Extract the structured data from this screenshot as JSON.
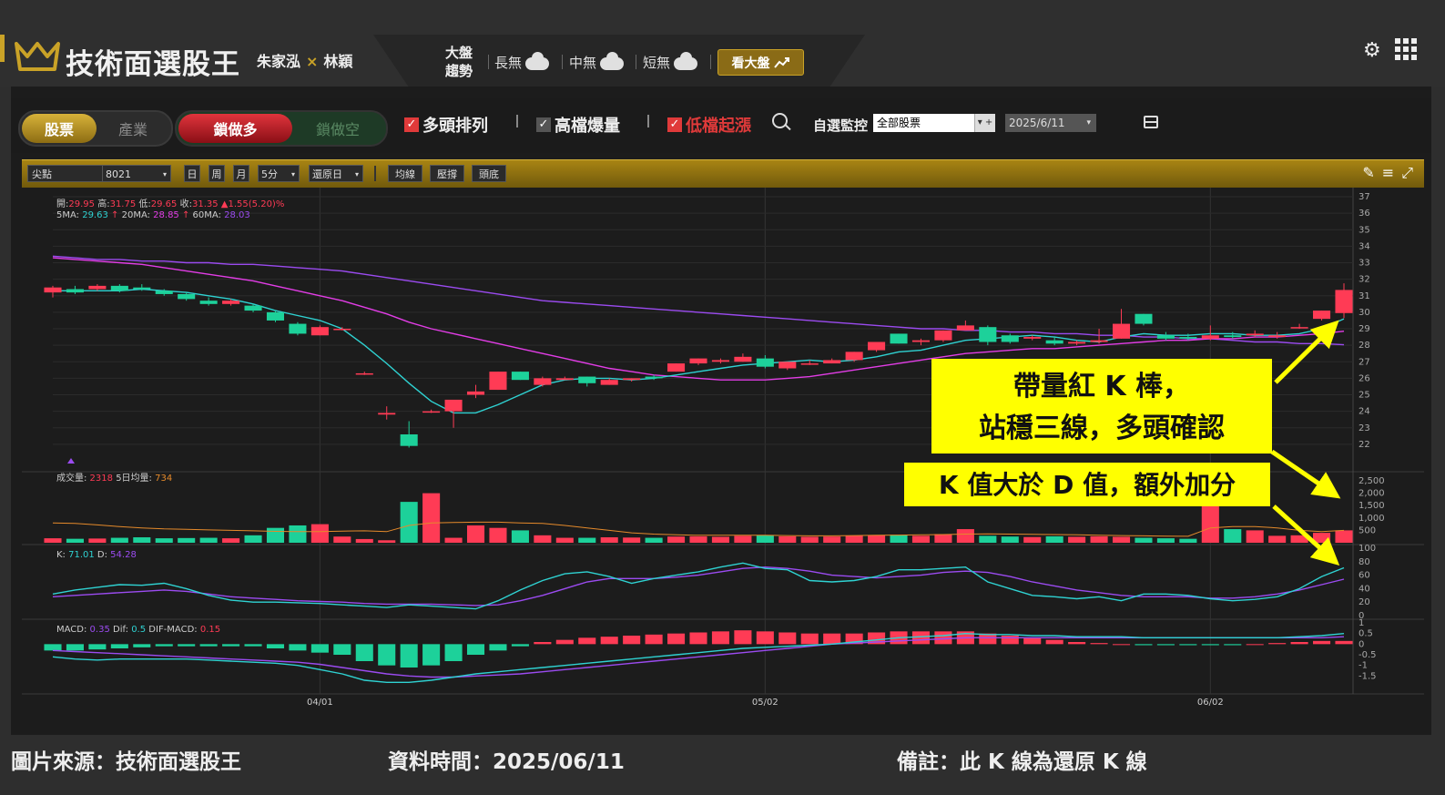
{
  "header": {
    "app_title": "技術面選股王",
    "authors_left": "朱家泓",
    "authors_x": "×",
    "authors_right": "林穎",
    "market_label": "大盤趨勢",
    "market_items": [
      {
        "label": "長無",
        "icon": "cloud-icon"
      },
      {
        "label": "中無",
        "icon": "cloud-icon"
      },
      {
        "label": "短無",
        "icon": "cloud-icon"
      }
    ],
    "see_market_label": "看大盤",
    "accent_color": "#c9a227"
  },
  "filters": {
    "type_toggle": [
      "股票",
      "產業"
    ],
    "direction_toggle": [
      "鎖做多",
      "鎖做空"
    ],
    "checks": [
      {
        "label": "多頭排列",
        "checked": true
      },
      {
        "label": "高檔爆量",
        "checked": false
      },
      {
        "label": "低檔起漲",
        "checked": true
      }
    ],
    "watch_label": "自選監控",
    "watch_value": "全部股票",
    "date_value": "2025/6/11"
  },
  "toolbar": {
    "field_label": "尖點",
    "stock_code": "8021",
    "periods": [
      "日",
      "周",
      "月"
    ],
    "interval": "5分",
    "adjust": "還原日",
    "buttons": [
      "均線",
      "壓撐",
      "頭底"
    ]
  },
  "chart_data": {
    "type": "candlestick",
    "x_ticks": [
      "04/01",
      "05/02",
      "06/02"
    ],
    "price_axis": {
      "ylim": [
        21,
        37
      ],
      "ticks": [
        22,
        23,
        24,
        25,
        26,
        27,
        28,
        29,
        30,
        31,
        32,
        33,
        34,
        35,
        36,
        37
      ]
    },
    "ohlc_info": {
      "open_label": "開:",
      "open": "29.95",
      "high_label": "高:",
      "high": "31.75",
      "low_label": "低:",
      "low": "29.65",
      "close_label": "收:",
      "close": "31.35",
      "change": "▲1.55(5.20)%"
    },
    "ma_info": {
      "ma5_label": "5MA:",
      "ma5": "29.63",
      "ma20_label": "20MA:",
      "ma20": "28.85",
      "ma60_label": "60MA:",
      "ma60": "28.03",
      "arrow": "↑"
    },
    "candles": [
      [
        31.2,
        31.6,
        30.9,
        31.5
      ],
      [
        31.4,
        31.6,
        31.1,
        31.2
      ],
      [
        31.4,
        31.7,
        31.3,
        31.6
      ],
      [
        31.6,
        31.7,
        31.2,
        31.3
      ],
      [
        31.5,
        31.7,
        31.3,
        31.4
      ],
      [
        31.3,
        31.4,
        31.0,
        31.1
      ],
      [
        31.1,
        31.2,
        30.7,
        30.8
      ],
      [
        30.7,
        30.9,
        30.4,
        30.5
      ],
      [
        30.5,
        30.8,
        30.4,
        30.7
      ],
      [
        30.4,
        30.5,
        30.0,
        30.1
      ],
      [
        30.0,
        30.1,
        29.4,
        29.5
      ],
      [
        29.3,
        29.4,
        28.6,
        28.7
      ],
      [
        28.6,
        29.2,
        28.6,
        29.1
      ],
      [
        29.0,
        29.1,
        28.9,
        29.0
      ],
      [
        26.3,
        26.4,
        26.2,
        26.3
      ],
      [
        23.8,
        24.3,
        23.5,
        23.9
      ],
      [
        22.6,
        23.4,
        21.8,
        21.9
      ],
      [
        24.0,
        24.1,
        23.9,
        24.0
      ],
      [
        24.0,
        24.6,
        23.0,
        24.7
      ],
      [
        25.0,
        25.6,
        24.8,
        25.2
      ],
      [
        25.3,
        26.4,
        25.3,
        26.4
      ],
      [
        26.4,
        26.4,
        25.9,
        25.9
      ],
      [
        25.6,
        26.1,
        25.5,
        26.0
      ],
      [
        25.9,
        26.1,
        25.9,
        26.0
      ],
      [
        26.1,
        26.1,
        25.5,
        25.7
      ],
      [
        25.6,
        26.0,
        25.6,
        25.9
      ],
      [
        25.9,
        26.0,
        25.8,
        26.0
      ],
      [
        26.1,
        26.2,
        25.9,
        26.0
      ],
      [
        26.4,
        26.9,
        26.4,
        26.9
      ],
      [
        26.9,
        27.2,
        26.8,
        27.2
      ],
      [
        27.0,
        27.2,
        26.9,
        27.1
      ],
      [
        27.0,
        27.5,
        27.0,
        27.3
      ],
      [
        27.2,
        27.4,
        26.6,
        26.7
      ],
      [
        26.6,
        27.0,
        26.5,
        27.0
      ],
      [
        26.9,
        27.1,
        26.8,
        26.9
      ],
      [
        26.9,
        27.2,
        26.9,
        27.1
      ],
      [
        27.1,
        27.6,
        27.0,
        27.6
      ],
      [
        27.7,
        28.2,
        27.6,
        28.2
      ],
      [
        28.7,
        28.7,
        28.1,
        28.1
      ],
      [
        28.2,
        28.4,
        28.0,
        28.3
      ],
      [
        28.3,
        28.9,
        28.2,
        28.9
      ],
      [
        28.9,
        29.5,
        28.9,
        29.2
      ],
      [
        29.1,
        29.2,
        28.0,
        28.2
      ],
      [
        28.6,
        28.7,
        28.1,
        28.2
      ],
      [
        28.4,
        28.6,
        28.3,
        28.5
      ],
      [
        28.3,
        28.5,
        28.0,
        28.1
      ],
      [
        28.1,
        28.3,
        28.0,
        28.2
      ],
      [
        28.2,
        29.0,
        28.1,
        28.3
      ],
      [
        28.4,
        30.2,
        28.4,
        29.3
      ],
      [
        29.9,
        29.9,
        29.2,
        29.3
      ],
      [
        28.6,
        28.8,
        28.3,
        28.4
      ],
      [
        28.5,
        28.7,
        28.3,
        28.4
      ],
      [
        28.4,
        29.2,
        28.3,
        28.6
      ],
      [
        28.6,
        28.8,
        28.4,
        28.5
      ],
      [
        28.6,
        28.9,
        28.5,
        28.7
      ],
      [
        28.5,
        28.8,
        28.4,
        28.6
      ],
      [
        29.1,
        29.3,
        29.0,
        29.1
      ],
      [
        29.6,
        30.1,
        29.5,
        30.1
      ],
      [
        29.95,
        31.75,
        29.65,
        31.35
      ]
    ],
    "ma5": [
      31.3,
      31.3,
      31.3,
      31.3,
      31.4,
      31.3,
      31.2,
      31.0,
      30.8,
      30.5,
      30.1,
      29.8,
      29.5,
      29.0,
      28.0,
      26.9,
      25.7,
      24.6,
      23.9,
      23.9,
      24.4,
      25.0,
      25.6,
      25.9,
      26.0,
      26.0,
      25.9,
      26.0,
      26.2,
      26.4,
      26.6,
      26.8,
      26.9,
      27.0,
      27.1,
      27.0,
      27.1,
      27.3,
      27.6,
      27.7,
      28.0,
      28.3,
      28.4,
      28.5,
      28.6,
      28.5,
      28.3,
      28.2,
      28.5,
      28.7,
      28.6,
      28.6,
      28.7,
      28.7,
      28.6,
      28.6,
      28.7,
      29.0,
      29.6
    ],
    "ma20": [
      33.3,
      33.2,
      33.1,
      33.0,
      32.9,
      32.7,
      32.5,
      32.3,
      32.1,
      31.9,
      31.6,
      31.3,
      31.0,
      30.7,
      30.3,
      29.9,
      29.4,
      29.0,
      28.7,
      28.4,
      28.1,
      27.8,
      27.5,
      27.2,
      26.9,
      26.6,
      26.4,
      26.2,
      26.1,
      26.0,
      25.9,
      25.9,
      25.9,
      26.0,
      26.1,
      26.3,
      26.5,
      26.7,
      26.9,
      27.1,
      27.3,
      27.5,
      27.6,
      27.7,
      27.8,
      27.8,
      27.9,
      28.0,
      28.1,
      28.2,
      28.3,
      28.3,
      28.4,
      28.4,
      28.5,
      28.5,
      28.6,
      28.7,
      28.85
    ],
    "ma60": [
      33.4,
      33.3,
      33.2,
      33.2,
      33.1,
      33.1,
      33.0,
      33.0,
      32.9,
      32.9,
      32.8,
      32.7,
      32.6,
      32.5,
      32.3,
      32.1,
      31.9,
      31.7,
      31.5,
      31.3,
      31.1,
      30.9,
      30.7,
      30.6,
      30.5,
      30.4,
      30.3,
      30.2,
      30.1,
      30.0,
      29.9,
      29.8,
      29.7,
      29.6,
      29.5,
      29.4,
      29.3,
      29.2,
      29.1,
      29.0,
      29.0,
      28.9,
      28.9,
      28.8,
      28.8,
      28.7,
      28.7,
      28.6,
      28.6,
      28.5,
      28.5,
      28.4,
      28.4,
      28.3,
      28.2,
      28.2,
      28.1,
      28.1,
      28.03
    ],
    "volume": {
      "label": "成交量:",
      "value": "2318",
      "avg_label": "5日均量:",
      "avg_value": "734",
      "ylim": [
        0,
        2500
      ],
      "ticks": [
        500,
        1000,
        1500,
        2000,
        2500
      ],
      "values": [
        180,
        160,
        170,
        200,
        220,
        180,
        190,
        200,
        180,
        300,
        600,
        700,
        750,
        250,
        150,
        100,
        1650,
        2000,
        200,
        700,
        600,
        500,
        300,
        200,
        200,
        220,
        210,
        200,
        250,
        260,
        240,
        280,
        300,
        260,
        240,
        250,
        280,
        300,
        320,
        280,
        350,
        550,
        280,
        250,
        230,
        260,
        240,
        260,
        240,
        200,
        180,
        160,
        1900,
        550,
        500,
        280,
        300,
        400,
        500,
        2318
      ],
      "ma5": [
        800,
        780,
        720,
        650,
        600,
        560,
        540,
        520,
        500,
        480,
        460,
        450,
        450,
        470,
        480,
        450,
        700,
        800,
        820,
        830,
        830,
        800,
        780,
        700,
        600,
        500,
        400,
        350,
        320,
        300,
        300,
        300,
        300,
        290,
        280,
        280,
        290,
        300,
        310,
        320,
        330,
        350,
        360,
        350,
        340,
        330,
        320,
        300,
        290,
        280,
        270,
        260,
        600,
        650,
        650,
        600,
        500,
        450,
        500,
        734
      ],
      "up_color": "#ff3b55",
      "down_color": "#1dd19a"
    },
    "kd": {
      "k_label": "K:",
      "k": "71.01",
      "d_label": "D:",
      "d": "54.28",
      "ylim": [
        0,
        100
      ],
      "ticks": [
        0,
        20,
        40,
        60,
        80,
        100
      ],
      "k_values": [
        32,
        38,
        42,
        46,
        45,
        48,
        40,
        30,
        23,
        20,
        20,
        19,
        18,
        16,
        14,
        12,
        16,
        14,
        12,
        10,
        22,
        38,
        52,
        62,
        65,
        58,
        48,
        55,
        60,
        65,
        72,
        78,
        70,
        68,
        52,
        50,
        52,
        58,
        68,
        68,
        70,
        72,
        50,
        40,
        30,
        28,
        25,
        28,
        22,
        32,
        32,
        30,
        25,
        22,
        24,
        28,
        40,
        58,
        71
      ],
      "d_values": [
        28,
        30,
        32,
        34,
        36,
        38,
        36,
        32,
        28,
        26,
        24,
        22,
        21,
        20,
        18,
        17,
        17,
        17,
        16,
        15,
        16,
        22,
        30,
        40,
        50,
        55,
        55,
        55,
        57,
        60,
        65,
        70,
        72,
        70,
        66,
        60,
        58,
        56,
        58,
        60,
        64,
        66,
        64,
        58,
        50,
        44,
        38,
        34,
        30,
        28,
        28,
        28,
        26,
        26,
        28,
        32,
        38,
        46,
        54
      ]
    },
    "macd": {
      "macd_label": "MACD:",
      "macd": "0.35",
      "dif_label": "Dif:",
      "dif": "0.5",
      "osc_label": "DIF-MACD:",
      "osc": "0.15",
      "ylim": [
        -2,
        1
      ],
      "ticks": [
        -1.5,
        -1,
        -0.5,
        0,
        0.5,
        1
      ],
      "osc_values": [
        -0.3,
        -0.3,
        -0.25,
        -0.2,
        -0.15,
        -0.1,
        -0.1,
        -0.1,
        -0.1,
        -0.1,
        -0.2,
        -0.3,
        -0.4,
        -0.5,
        -0.8,
        -1.0,
        -1.1,
        -1.0,
        -0.8,
        -0.5,
        -0.3,
        -0.1,
        0.1,
        0.2,
        0.3,
        0.35,
        0.4,
        0.45,
        0.5,
        0.55,
        0.6,
        0.65,
        0.6,
        0.55,
        0.5,
        0.5,
        0.5,
        0.55,
        0.6,
        0.6,
        0.6,
        0.6,
        0.5,
        0.4,
        0.3,
        0.2,
        0.1,
        0.05,
        0.0,
        -0.05,
        -0.05,
        -0.05,
        -0.05,
        -0.05,
        0.0,
        0.05,
        0.1,
        0.15,
        0.15
      ],
      "dif_values": [
        -0.6,
        -0.7,
        -0.75,
        -0.7,
        -0.7,
        -0.7,
        -0.7,
        -0.75,
        -0.8,
        -0.85,
        -0.9,
        -1.0,
        -1.2,
        -1.4,
        -1.7,
        -1.8,
        -1.8,
        -1.7,
        -1.55,
        -1.4,
        -1.3,
        -1.2,
        -1.1,
        -1.0,
        -0.9,
        -0.8,
        -0.7,
        -0.6,
        -0.5,
        -0.4,
        -0.3,
        -0.2,
        -0.15,
        -0.1,
        -0.05,
        0.0,
        0.1,
        0.2,
        0.3,
        0.35,
        0.4,
        0.5,
        0.45,
        0.45,
        0.4,
        0.4,
        0.35,
        0.35,
        0.35,
        0.3,
        0.3,
        0.3,
        0.3,
        0.3,
        0.3,
        0.3,
        0.35,
        0.4,
        0.5
      ],
      "macd_values": [
        -0.3,
        -0.35,
        -0.4,
        -0.45,
        -0.5,
        -0.55,
        -0.6,
        -0.65,
        -0.7,
        -0.75,
        -0.8,
        -0.85,
        -0.95,
        -1.1,
        -1.25,
        -1.4,
        -1.5,
        -1.55,
        -1.55,
        -1.5,
        -1.45,
        -1.4,
        -1.3,
        -1.2,
        -1.1,
        -1.0,
        -0.9,
        -0.8,
        -0.7,
        -0.6,
        -0.5,
        -0.4,
        -0.3,
        -0.2,
        -0.1,
        0.0,
        0.05,
        0.1,
        0.15,
        0.2,
        0.25,
        0.3,
        0.3,
        0.3,
        0.3,
        0.3,
        0.3,
        0.3,
        0.3,
        0.3,
        0.3,
        0.3,
        0.3,
        0.3,
        0.3,
        0.3,
        0.3,
        0.3,
        0.35
      ]
    },
    "colors": {
      "up": "#ff3b55",
      "down": "#1dd19a",
      "ma5": "#2fd2d2",
      "ma20": "#e23de6",
      "ma60": "#9b4bf0",
      "k": "#2fd2d2",
      "d": "#9b4bf0"
    }
  },
  "annotations": {
    "box1_line1": "帶量紅 K 棒，",
    "box1_line2": "站穩三線，多頭確認",
    "box2": "K 值大於 D 值，額外加分",
    "box_color": "#ffff00"
  },
  "footer": {
    "source": "圖片來源：技術面選股王",
    "date": "資料時間：2025/06/11",
    "note": "備註：此 K 線為還原 K 線"
  }
}
